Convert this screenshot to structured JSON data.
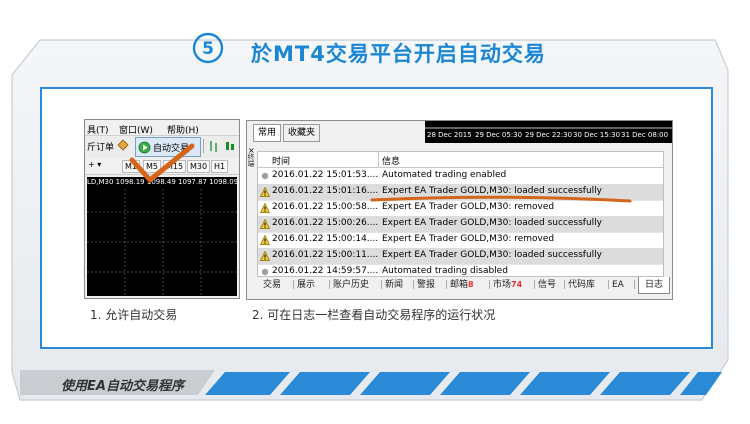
{
  "header": {
    "step_number": "5",
    "title": "於MT4交易平台开启自动交易"
  },
  "screenshot_left": {
    "menu": [
      "具(T)",
      "窗口(W)",
      "帮助(H)"
    ],
    "toolbar": {
      "new_order": "斤订单",
      "auto_trading": "自动交易"
    },
    "timeframes": [
      "M1",
      "M5",
      "M15",
      "M30",
      "H1"
    ],
    "chart_caption": "LD,M30  1098.19  1098.49  1097.87  1098.09",
    "caption": "1. 允许自动交易"
  },
  "screenshot_right": {
    "top_tabs": [
      "常用",
      "收藏夹"
    ],
    "timeline_labels": [
      "28 Dec 2015",
      "29 Dec 05:30",
      "29 Dec 22:30",
      "30 Dec 15:30",
      "31 Dec 08:00"
    ],
    "side_label": "终端",
    "close_icon": "×",
    "columns": {
      "time": "时间",
      "message": "信息"
    },
    "rows": [
      {
        "icon": "info",
        "time": "2016.01.22 15:01:53....",
        "message": "Automated trading enabled"
      },
      {
        "icon": "warning",
        "time": "2016.01.22 15:01:16....",
        "message": "Expert EA Trader GOLD,M30: loaded successfully"
      },
      {
        "icon": "warning",
        "time": "2016.01.22 15:00:58....",
        "message": "Expert EA Trader GOLD,M30: removed"
      },
      {
        "icon": "warning",
        "time": "2016.01.22 15:00:26....",
        "message": "Expert EA Trader GOLD,M30: loaded successfully"
      },
      {
        "icon": "warning",
        "time": "2016.01.22 15:00:14....",
        "message": "Expert EA Trader GOLD,M30: removed"
      },
      {
        "icon": "warning",
        "time": "2016.01.22 15:00:11....",
        "message": "Expert EA Trader GOLD,M30: loaded successfully"
      },
      {
        "icon": "info",
        "time": "2016.01.22 14:59:57....",
        "message": "Automated trading disabled"
      }
    ],
    "bottom_tabs": [
      {
        "label": "交易",
        "badge": ""
      },
      {
        "label": "展示",
        "badge": ""
      },
      {
        "label": "账户历史",
        "badge": ""
      },
      {
        "label": "新闻",
        "badge": ""
      },
      {
        "label": "警报",
        "badge": ""
      },
      {
        "label": "邮箱",
        "badge": "8"
      },
      {
        "label": "市场",
        "badge": "74"
      },
      {
        "label": "信号",
        "badge": ""
      },
      {
        "label": "代码库",
        "badge": ""
      },
      {
        "label": "EA",
        "badge": ""
      },
      {
        "label": "日志",
        "badge": ""
      }
    ],
    "caption": "2. 可在日志一栏查看自动交易程序的运行状况"
  },
  "footer": {
    "text": "使用EA自动交易程序"
  },
  "colors": {
    "accent_blue": "#1b86d4",
    "highlight_orange": "#d4661c",
    "badge_red": "#e23030"
  }
}
